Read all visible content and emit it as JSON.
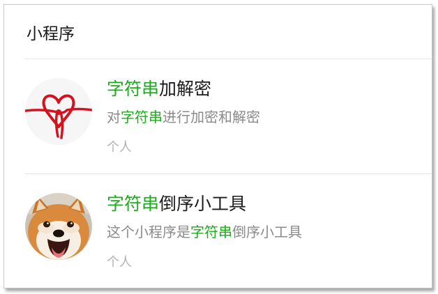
{
  "section": {
    "title": "小程序"
  },
  "colors": {
    "highlight": "#1aad19",
    "title": "#1a1a1a",
    "desc": "#8a8a8a",
    "type": "#b2b2b2"
  },
  "results": [
    {
      "name_hl": "字符串",
      "name_rest": "加解密",
      "desc_pre": "对",
      "desc_hl": "字符串",
      "desc_post": "进行加密和解密",
      "type": "个人",
      "avatar_icon": "red-heart-knot-icon"
    },
    {
      "name_hl": "字符串",
      "name_rest": "倒序小工具",
      "desc_pre": "这个小程序是",
      "desc_hl": "字符串",
      "desc_post": "倒序小工具",
      "type": "个人",
      "avatar_icon": "shiba-dog-avatar"
    }
  ]
}
